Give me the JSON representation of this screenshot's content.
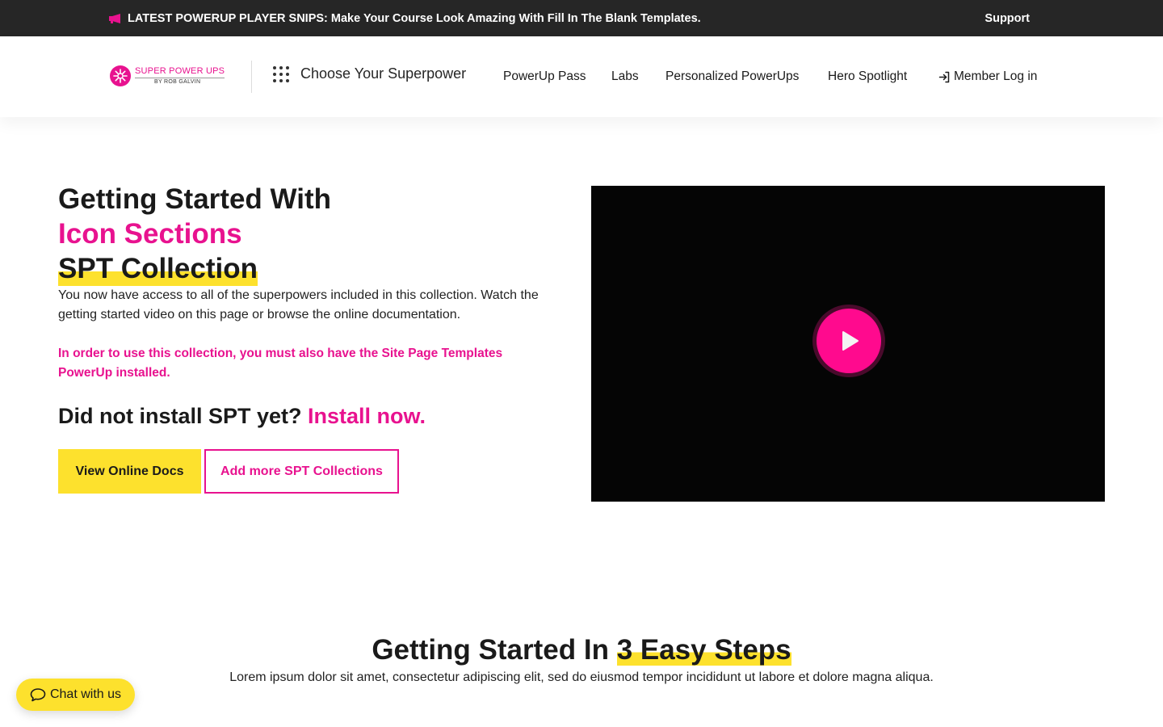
{
  "announcement": {
    "message": "LATEST POWERUP PLAYER SNIPS: Make Your Course Look Amazing With Fill In The Blank Templates.",
    "support_label": "Support"
  },
  "header": {
    "logo_brand": "SUPER POWER UPS",
    "logo_by": "BY ROB GALVIN",
    "choose_label": "Choose Your Superpower",
    "nav": [
      "PowerUp Pass",
      "Labs",
      "Personalized PowerUps",
      "Hero Spotlight",
      "Member Log in"
    ]
  },
  "hero": {
    "title_line1": "Getting Started With",
    "title_line2": "Icon Sections",
    "title_line3": "SPT Collection",
    "description": "You now have access to all of the superpowers included in this collection. Watch the getting started video on this page or browse the online documentation.",
    "warning": "In order to use this collection, you must also have the Site Page Templates PowerUp installed.",
    "install_prefix": "Did not install SPT yet? ",
    "install_link": "Install now.",
    "primary_button": "View Online Docs",
    "secondary_button": "Add more SPT Collections"
  },
  "steps": {
    "title_prefix": "Getting Started In ",
    "title_highlight": "3 Easy Steps",
    "description": "Lorem ipsum dolor sit amet, consectetur adipiscing elit, sed do eiusmod tempor incididunt ut labore et dolore magna aliqua."
  },
  "chat": {
    "label": "Chat with us"
  },
  "colors": {
    "accent_pink": "#e8128f",
    "accent_yellow": "#fde12d",
    "topbar": "#262626"
  },
  "icons": [
    "megaphone-icon",
    "grid-dots-icon",
    "login-icon",
    "play-icon",
    "chat-bubble-icon"
  ]
}
